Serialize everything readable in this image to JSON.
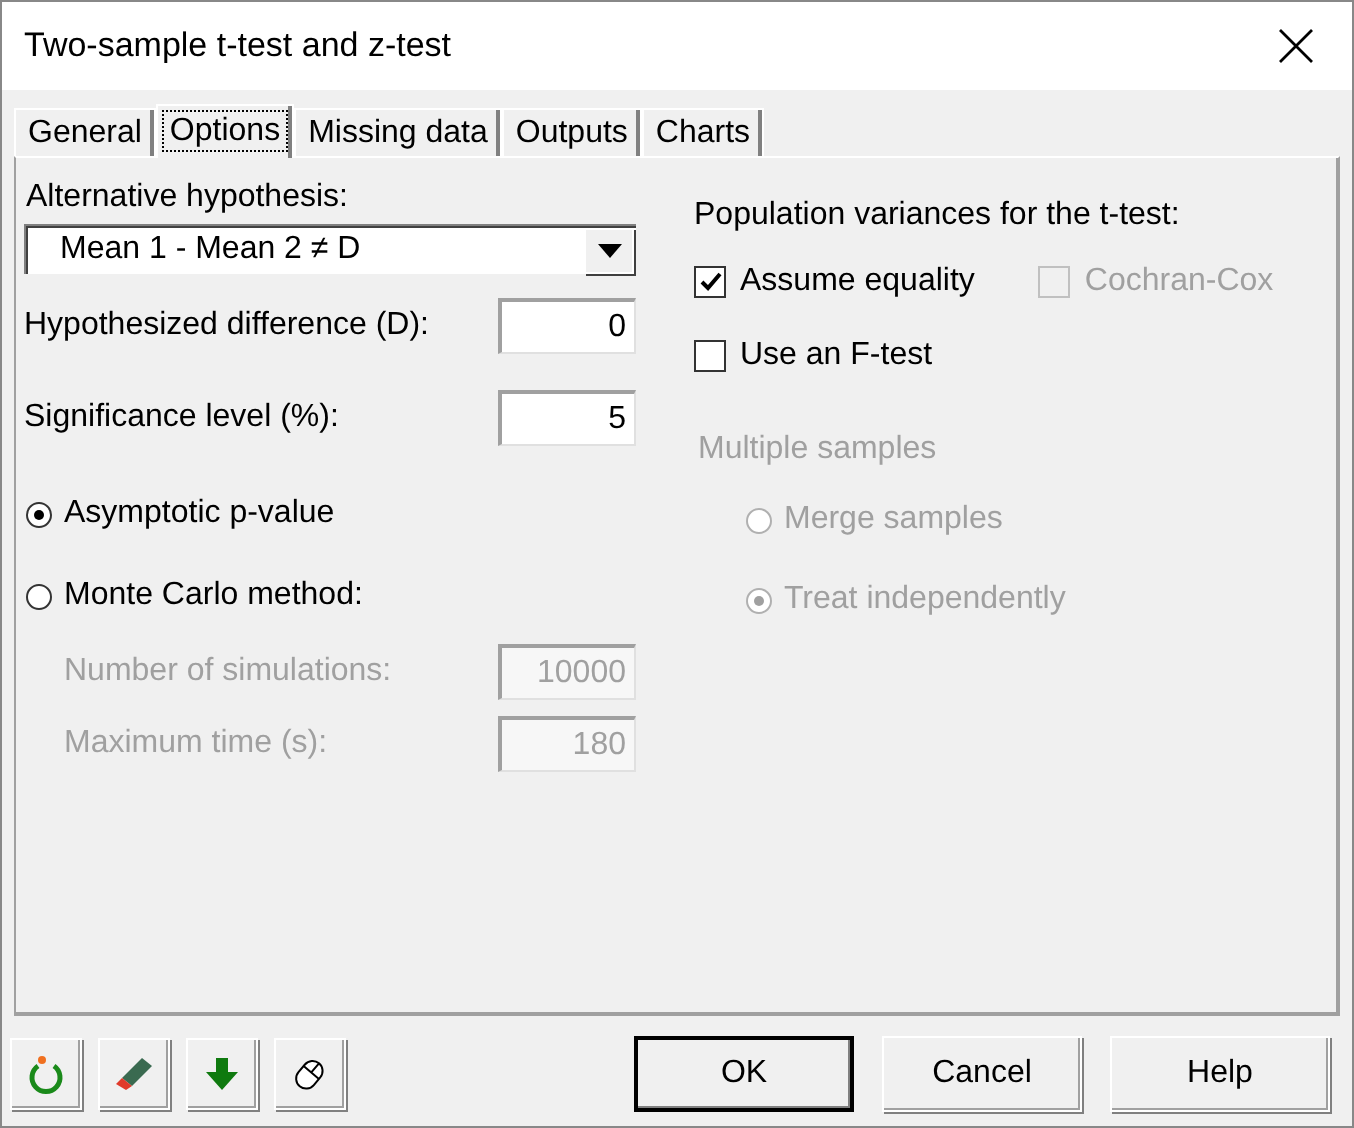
{
  "window": {
    "title": "Two-sample t-test and z-test"
  },
  "tabs": [
    {
      "label": "General",
      "selected": false
    },
    {
      "label": "Options",
      "selected": true
    },
    {
      "label": "Missing data",
      "selected": false
    },
    {
      "label": "Outputs",
      "selected": false
    },
    {
      "label": "Charts",
      "selected": false
    }
  ],
  "alternative_hypothesis": {
    "label": "Alternative hypothesis:",
    "value": "Mean 1 - Mean 2 ≠ D"
  },
  "fields": [
    {
      "label": "Hypothesized difference (D):",
      "value": "0",
      "disabled": false
    },
    {
      "label": "Significance level (%):",
      "value": "5",
      "disabled": false
    }
  ],
  "p_value_methods": [
    {
      "label": "Asymptotic p-value",
      "selected": true
    },
    {
      "label": "Monte Carlo method:",
      "selected": false
    }
  ],
  "monte_carlo_fields": [
    {
      "label": "Number of simulations:",
      "value": "10000",
      "disabled": true
    },
    {
      "label": "Maximum time (s):",
      "value": "180",
      "disabled": true
    }
  ],
  "population_variances": {
    "label": "Population variances for the t-test:",
    "checkbox_rows": [
      [
        {
          "label": "Assume equality",
          "checked": true,
          "disabled": false
        },
        {
          "label": "Cochran-Cox",
          "checked": false,
          "disabled": true
        }
      ],
      [
        {
          "label": "Use an F-test",
          "checked": false,
          "disabled": false
        }
      ]
    ]
  },
  "multiple_samples": {
    "label": "Multiple samples",
    "disabled": true,
    "options": [
      {
        "label": "Merge samples",
        "selected": false
      },
      {
        "label": "Treat independently",
        "selected": true
      }
    ]
  },
  "buttons": [
    {
      "label": "OK",
      "default": true
    },
    {
      "label": "Cancel",
      "default": false
    },
    {
      "label": "Help",
      "default": false
    }
  ]
}
